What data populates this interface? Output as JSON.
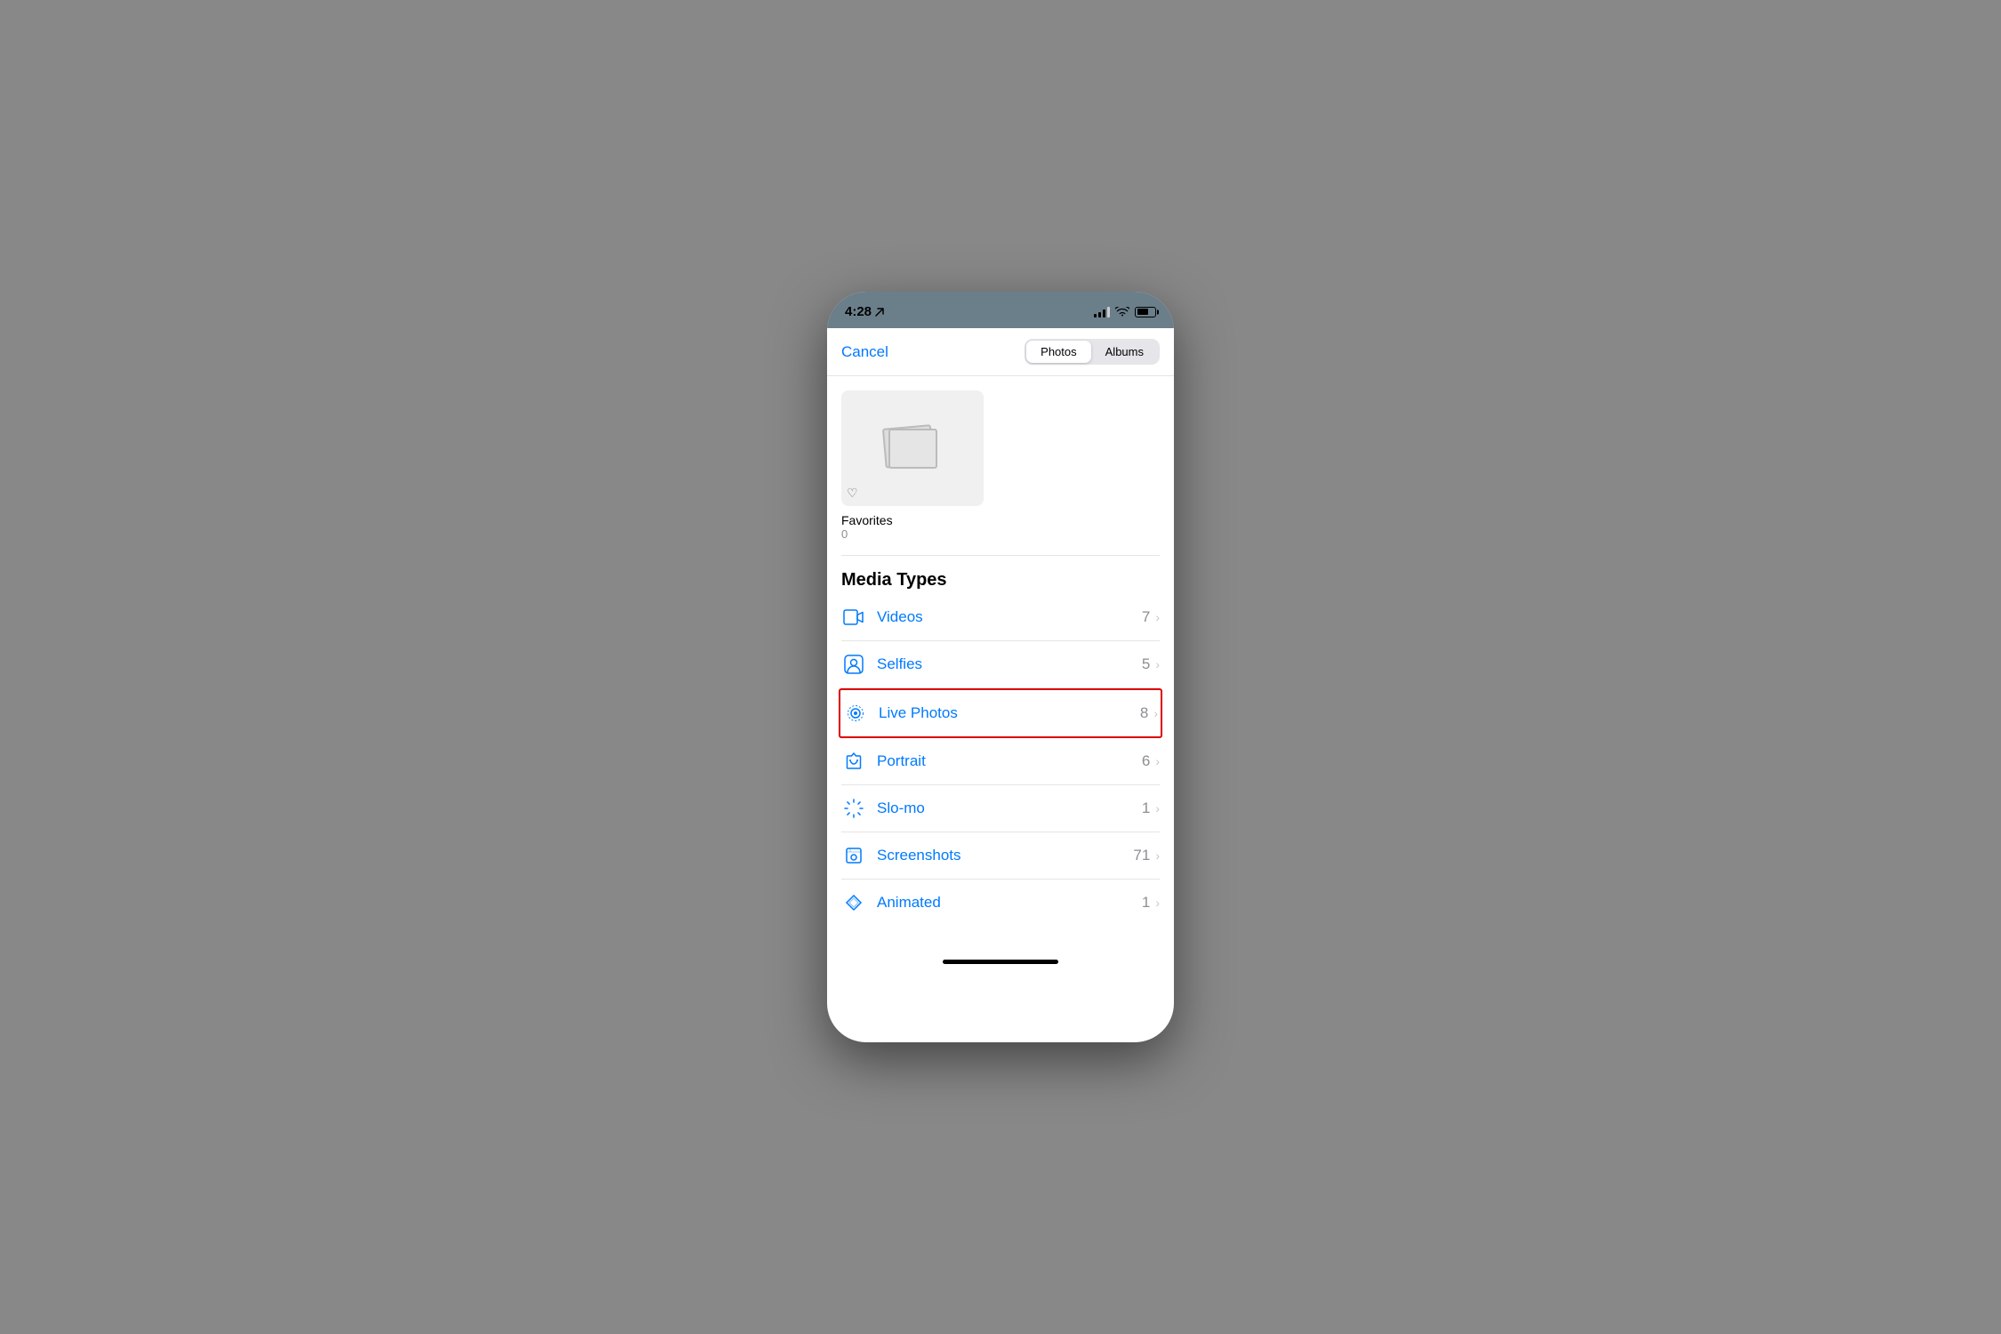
{
  "statusBar": {
    "time": "4:28",
    "locationArrow": "▶",
    "signalBars": [
      4,
      6,
      8,
      10,
      12
    ],
    "batteryPercent": 65
  },
  "navbar": {
    "cancelLabel": "Cancel",
    "tabs": [
      {
        "id": "photos",
        "label": "Photos",
        "active": true
      },
      {
        "id": "albums",
        "label": "Albums",
        "active": false
      }
    ]
  },
  "favoritesAlbum": {
    "label": "Favorites",
    "count": "0"
  },
  "mediaTypes": {
    "sectionTitle": "Media Types",
    "items": [
      {
        "id": "videos",
        "label": "Videos",
        "count": "7",
        "highlighted": false
      },
      {
        "id": "selfies",
        "label": "Selfies",
        "count": "5",
        "highlighted": false
      },
      {
        "id": "live-photos",
        "label": "Live Photos",
        "count": "8",
        "highlighted": true
      },
      {
        "id": "portrait",
        "label": "Portrait",
        "count": "6",
        "highlighted": false
      },
      {
        "id": "slo-mo",
        "label": "Slo-mo",
        "count": "1",
        "highlighted": false
      },
      {
        "id": "screenshots",
        "label": "Screenshots",
        "count": "71",
        "highlighted": false
      },
      {
        "id": "animated",
        "label": "Animated",
        "count": "1",
        "highlighted": false
      }
    ]
  }
}
